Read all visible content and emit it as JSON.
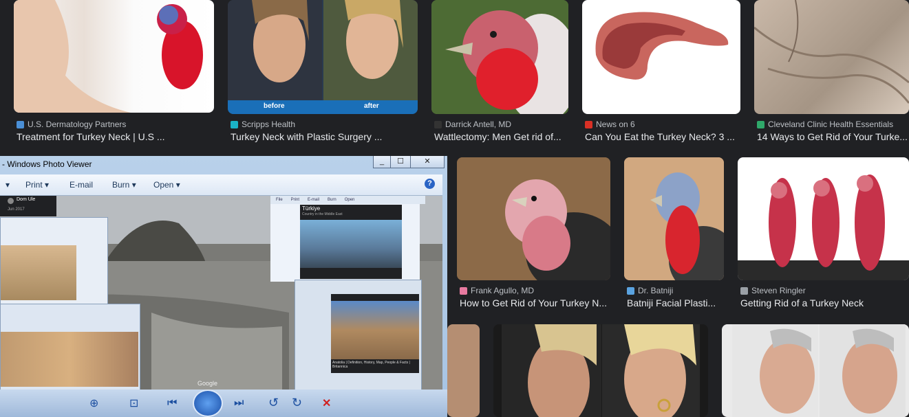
{
  "results_row1": [
    {
      "source": "U.S. Dermatology Partners",
      "title": "Treatment for Turkey Neck | U.S ...",
      "fav_color": "#4a8fd6"
    },
    {
      "source": "Scripps Health",
      "title": "Turkey Neck with Plastic Surgery ...",
      "fav_color": "#1ab3c7",
      "labels": [
        "before",
        "after"
      ]
    },
    {
      "source": "Darrick Antell, MD",
      "title": "Wattlectomy: Men Get rid of...",
      "fav_color": "#333333"
    },
    {
      "source": "News on 6",
      "title": "Can You Eat the Turkey Neck? 3 ...",
      "fav_color": "#d93025"
    },
    {
      "source": "Cleveland Clinic Health Essentials",
      "title": "14 Ways to Get Rid of Your Turke...",
      "fav_color": "#2fa86a"
    }
  ],
  "results_row2": [
    {
      "source": "Frank Agullo, MD",
      "title": "How to Get Rid of Your Turkey N...",
      "fav_color": "#e87aa0"
    },
    {
      "source": "Dr. Batniji",
      "title": "Batniji Facial Plasti...",
      "fav_color": "#5aa3e0"
    },
    {
      "source": "Steven Ringler",
      "title": "Getting Rid of a Turkey Neck",
      "fav_color": "#9aa0a6"
    }
  ],
  "viewer": {
    "title": "- Windows Photo Viewer",
    "menu": [
      "Print",
      "E-mail",
      "Burn",
      "Open"
    ],
    "help": "?",
    "window_buttons": [
      "_",
      "☐",
      "✕"
    ],
    "user_name": "Dom Ule",
    "user_date": "Jun 2017",
    "inner_title": "Türkiye",
    "inner_subtitle": "Country in the Middle East",
    "caption": "Anatolia | Definition, History, Map, People & Facts | Britannica",
    "watermark": "Google",
    "inner_menu": [
      "File",
      "Print",
      "E-mail",
      "Burn",
      "Open"
    ]
  },
  "icons": {
    "zoom": "⊕",
    "fit": "⊡",
    "prev": "⏮",
    "slideshow": "▣",
    "next": "⏭",
    "rotl": "↺",
    "rotr": "↻",
    "delete": "✕"
  }
}
